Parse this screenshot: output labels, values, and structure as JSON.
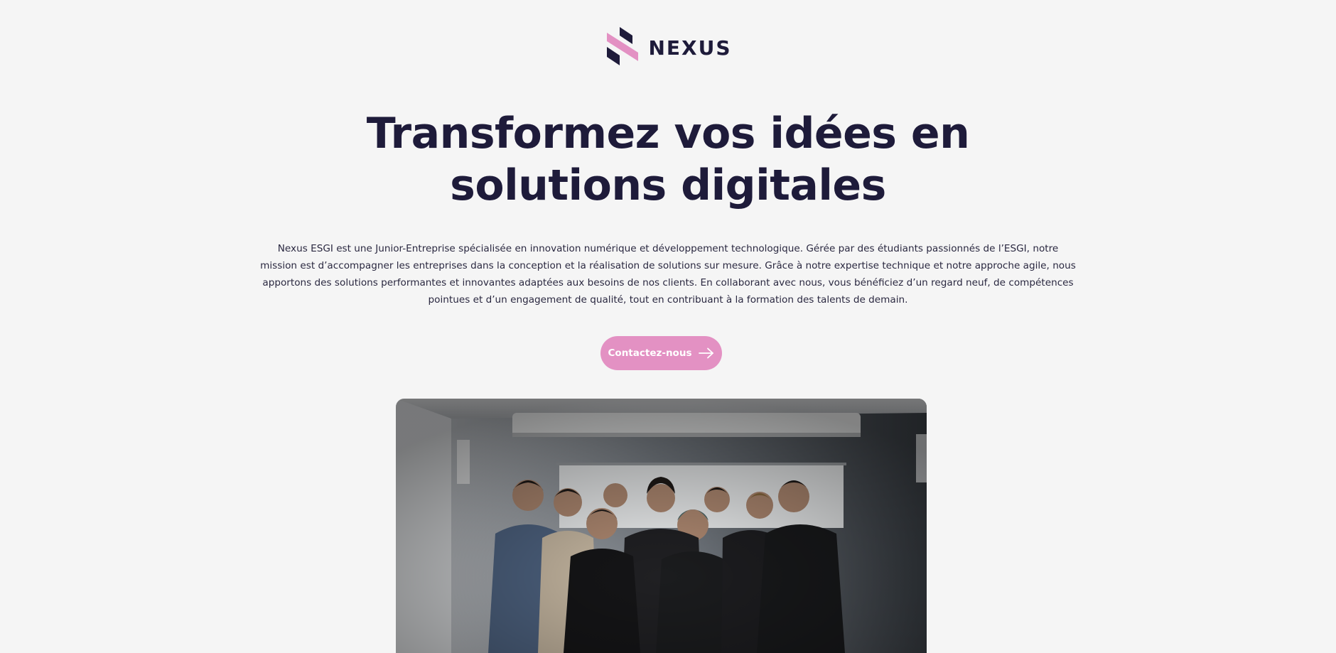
{
  "header": {
    "logo_text": "NEXUS",
    "logo_icon": "nexus-stripes-logo"
  },
  "hero": {
    "title_line1": "Transformez vos idées en",
    "title_line2": "solutions digitales",
    "description": "Nexus ESGI est une Junior-Entreprise spécialisée en innovation numérique et développement technologique. Gérée par des étudiants passionnés de l’ESGI, notre mission est d’accompagner les entreprises dans la conception et la réalisation de solutions sur mesure. Grâce à notre expertise technique et notre approche agile, nous apportons des solutions performantes et innovantes adaptées aux besoins de nos clients. En collaborant avec nous, vous bénéficiez d’un regard neuf, de compétences pointues et d’un engagement de qualité, tout en contribuant à la formation des talents de demain.",
    "cta_label": "Contactez-nous",
    "cta_icon": "arrow-right-icon"
  },
  "photo": {
    "subject": "team-group-photo"
  },
  "colors": {
    "background": "#f5f5f5",
    "navy": "#1e1b3a",
    "accent_pink": "#e391c3"
  }
}
